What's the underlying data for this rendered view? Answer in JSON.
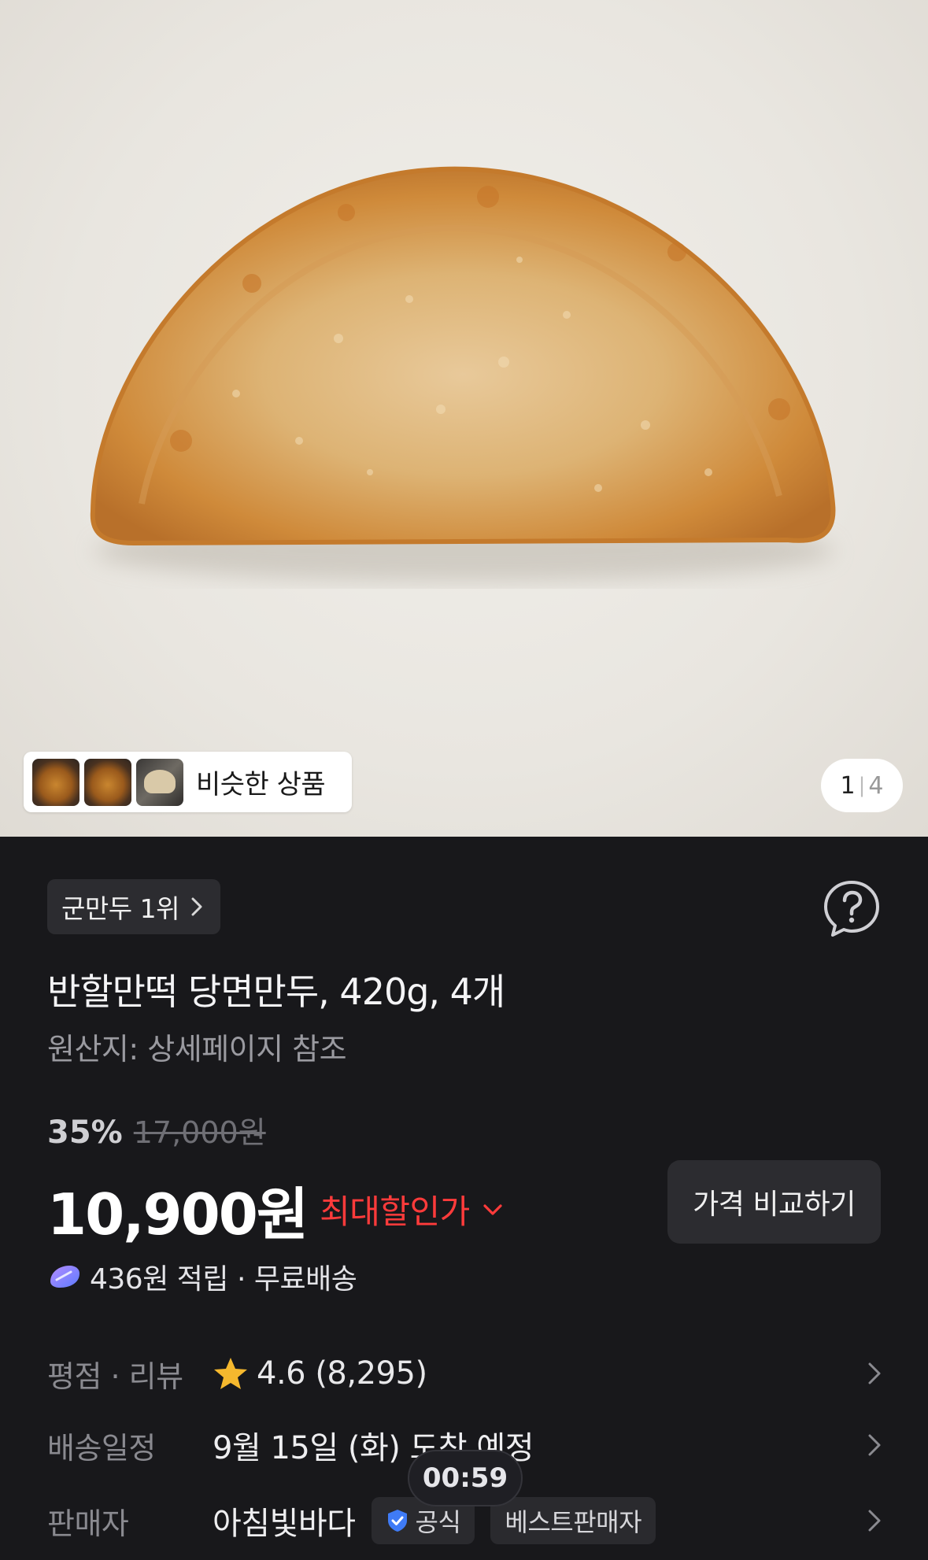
{
  "gallery": {
    "similar_label": "비슷한 상품",
    "current_index": "1",
    "total": "4",
    "similar_thumbnails": [
      "thumbnail-1",
      "thumbnail-2",
      "thumbnail-3"
    ]
  },
  "product": {
    "rank_chip": "군만두 1위",
    "title": "반할만떡 당면만두, 420g, 4개",
    "origin": "원산지: 상세페이지 참조",
    "discount_rate": "35%",
    "original_price": "17,000원",
    "price": "10,900원",
    "max_discount_label": "최대할인가",
    "compare_button": "가격 비교하기",
    "points_text": "436원 적립 · 무료배송"
  },
  "details": {
    "rating_label": "평점 · 리뷰",
    "rating_value": "4.6 (8,295)",
    "rating_stars": 4.6,
    "shipping_label": "배송일정",
    "shipping_value": "9월 15일 (화) 도착 예정",
    "seller_label": "판매자",
    "seller_name": "아침빛바다",
    "official_badge": "공식",
    "best_badge": "베스트판매자"
  },
  "overlay": {
    "timer": "00:59"
  },
  "colors": {
    "background": "#18181b",
    "discount_red": "#ff3b3b",
    "star_yellow": "#f5b82e",
    "verified_blue": "#3f7bf6"
  },
  "icons": [
    "help-bubble-icon",
    "chevron-right-icon",
    "chevron-down-icon",
    "star-icon",
    "points-coin-icon",
    "verified-shield-icon"
  ]
}
